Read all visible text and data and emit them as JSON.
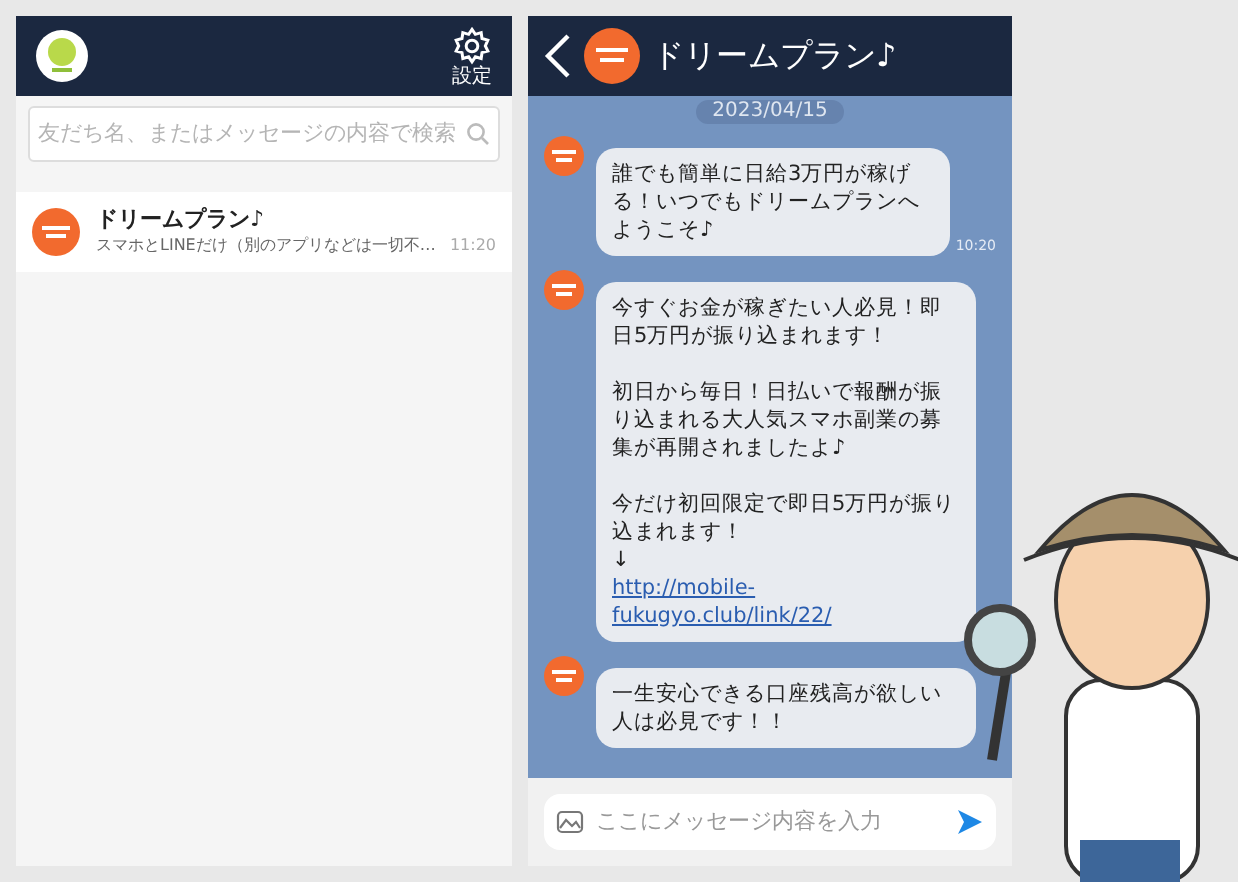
{
  "chat_list": {
    "settings_label": "設定",
    "search": {
      "placeholder": "友だち名、またはメッセージの内容で検索"
    },
    "items": [
      {
        "name": "ドリームプラン♪",
        "preview": "スマホとLINEだけ（別のアプリなどは一切不…",
        "time": "11:20",
        "selected": false
      }
    ]
  },
  "chat": {
    "title": "ドリームプラン♪",
    "date": "2023/04/15",
    "messages": [
      {
        "text": "誰でも簡単に日給3万円が稼げる！いつでもドリームプランへようこそ♪",
        "time": "10:20"
      },
      {
        "paragraphs": [
          [
            "今すぐお金が稼ぎたい人必見！即日5万円が振り込まれます！"
          ],
          [
            "初日から毎日！日払いで報酬が振り込まれる大人気スマホ副業の募集が再開されましたよ♪"
          ],
          [
            "今だけ初回限定で即日5万円が振り込まれます！",
            "↓"
          ]
        ],
        "link": "http://mobile-fukugyo.club/link/22/"
      },
      {
        "text": "一生安心できる口座残高が欲しい人は必見です！！"
      }
    ],
    "input": {
      "placeholder": "ここにメッセージ内容を入力"
    }
  }
}
